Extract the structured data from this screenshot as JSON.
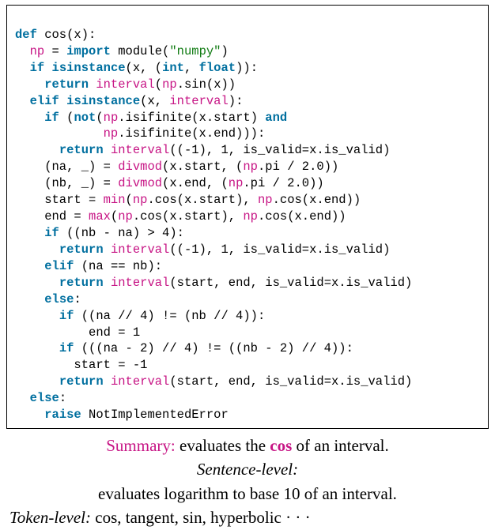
{
  "code": {
    "l1": {
      "kw_def": "def",
      "name": " cos(x):"
    },
    "l2": {
      "ind": "  ",
      "np": "np",
      "mid": " = ",
      "kw": "import",
      "rest": " module(",
      "str": "\"numpy\"",
      "close": ")"
    },
    "l3": {
      "ind": "  ",
      "kw_if": "if",
      "sp": " ",
      "kw_isinst": "isinstance",
      "rest": "(x, (",
      "bi_int": "int",
      "comma": ", ",
      "bi_float": "float",
      "close": ")):"
    },
    "l4": {
      "ind": "    ",
      "kw_ret": "return",
      "sp": " ",
      "intv": "interval",
      "open": "(",
      "np": "np",
      "rest": ".sin(x))"
    },
    "l5": {
      "ind": "  ",
      "kw_elif": "elif",
      "sp": " ",
      "kw_isinst": "isinstance",
      "open": "(x, ",
      "intv": "interval",
      "close": "):"
    },
    "l6": {
      "ind": "    ",
      "kw_if": "if",
      "open": " (",
      "kw_not": "not",
      "open2": "(",
      "np": "np",
      "rest": ".isifinite(x.start) ",
      "kw_and": "and"
    },
    "l7": {
      "ind": "            ",
      "np": "np",
      "rest": ".isifinite(x.end))):"
    },
    "l8": {
      "ind": "      ",
      "kw_ret": "return",
      "sp": " ",
      "intv": "interval",
      "rest": "((-1), 1, is_valid=x.is_valid)"
    },
    "l9": {
      "ind": "    (na, _) = ",
      "fn": "divmod",
      "open": "(x.start, (",
      "np": "np",
      "rest": ".pi / 2.0))"
    },
    "l10": {
      "ind": "    (nb, _) = ",
      "fn": "divmod",
      "open": "(x.end, (",
      "np": "np",
      "rest": ".pi / 2.0))"
    },
    "l11": {
      "ind": "    start = ",
      "fn": "min",
      "open": "(",
      "np1": "np",
      "mid": ".cos(x.start), ",
      "np2": "np",
      "rest": ".cos(x.end))"
    },
    "l12": {
      "ind": "    end = ",
      "fn": "max",
      "open": "(",
      "np1": "np",
      "mid": ".cos(x.start), ",
      "np2": "np",
      "rest": ".cos(x.end))"
    },
    "l13": {
      "ind": "    ",
      "kw_if": "if",
      "rest": " ((nb - na) > 4):"
    },
    "l14": {
      "ind": "      ",
      "kw_ret": "return",
      "sp": " ",
      "intv": "interval",
      "rest": "((-1), 1, is_valid=x.is_valid)"
    },
    "l15": {
      "ind": "    ",
      "kw_elif": "elif",
      "rest": " (na == nb):"
    },
    "l16": {
      "ind": "      ",
      "kw_ret": "return",
      "sp": " ",
      "intv": "interval",
      "rest": "(start, end, is_valid=x.is_valid)"
    },
    "l17": {
      "ind": "    ",
      "kw_else": "else",
      "colon": ":"
    },
    "l18": {
      "ind": "      ",
      "kw_if": "if",
      "rest": " ((na // 4) != (nb // 4)):"
    },
    "l19": {
      "ind": "          end = 1"
    },
    "l20": {
      "ind": "      ",
      "kw_if": "if",
      "rest": " (((na - 2) // 4) != ((nb - 2) // 4)):"
    },
    "l21": {
      "ind": "        start = -1"
    },
    "l22": {
      "ind": "      ",
      "kw_ret": "return",
      "sp": " ",
      "intv": "interval",
      "rest": "(start, end, is_valid=x.is_valid)"
    },
    "l23": {
      "ind": "  ",
      "kw_else": "else",
      "colon": ":"
    },
    "l24": {
      "ind": "    ",
      "kw_raise": "raise",
      "rest": " NotImplementedError"
    }
  },
  "caption": {
    "summary_label": "Summary:",
    "summary_pre": " evaluates the ",
    "summary_cos": "cos",
    "summary_post": " of an interval.",
    "sent_label": "Sentence-level:",
    "sent_text": "evaluates logarithm to base 10 of an interval.",
    "token_label": "Token-level:",
    "token_text": " cos, tangent, sin, hyperbolic · · ·"
  }
}
